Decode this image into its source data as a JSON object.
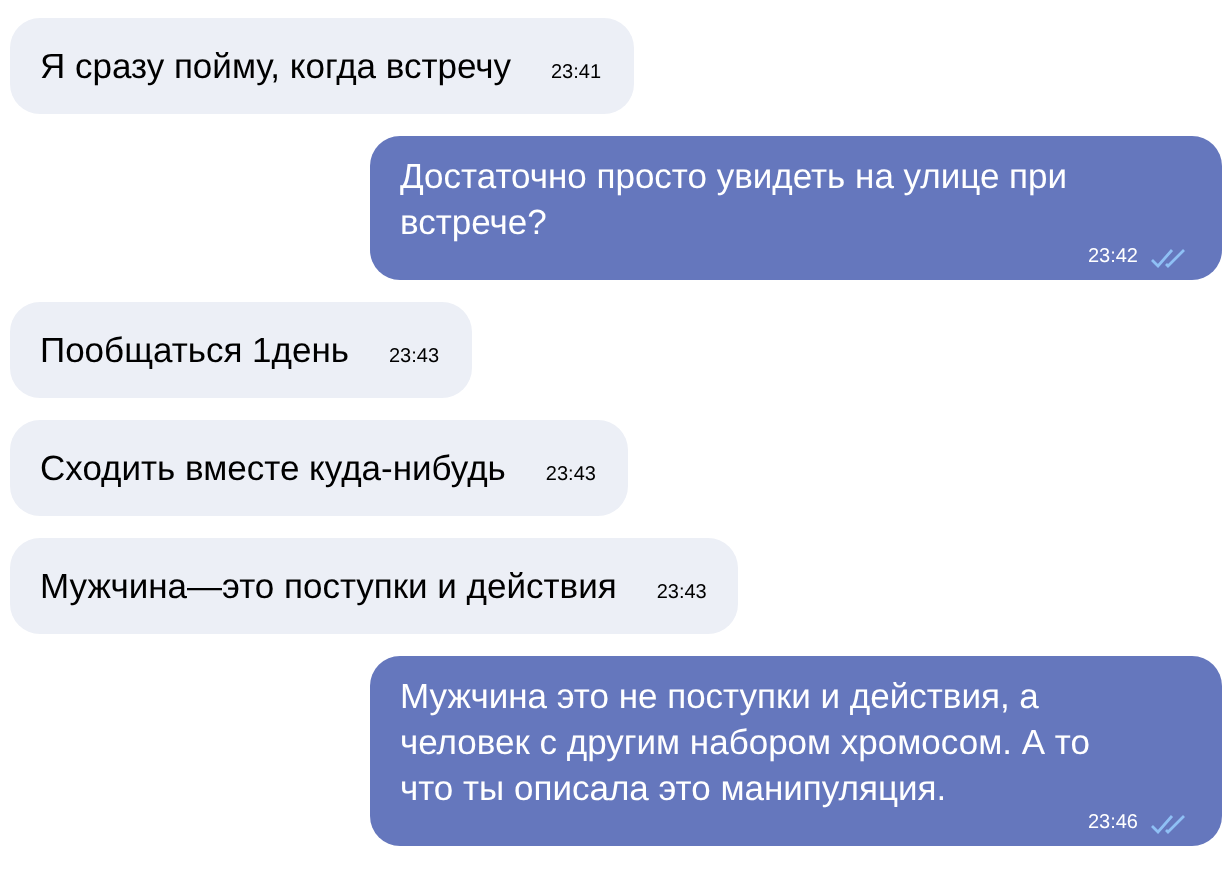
{
  "messages": [
    {
      "kind": "incoming",
      "text": "Я сразу пойму, когда встречу",
      "time": "23:41"
    },
    {
      "kind": "outgoing",
      "text": "Достаточно просто увидеть на улице при встрече?",
      "time": "23:42",
      "read": true
    },
    {
      "kind": "incoming",
      "text": "Пообщаться 1день",
      "time": "23:43"
    },
    {
      "kind": "incoming",
      "text": "Сходить вместе куда-нибудь",
      "time": "23:43"
    },
    {
      "kind": "incoming",
      "text": "Мужчина—это поступки и действия",
      "time": "23:43"
    },
    {
      "kind": "outgoing",
      "text": "Мужчина это не поступки и действия, а человек с другим набором хромосом. А то что ты описала это манипуляция.",
      "time": "23:46",
      "read": true
    }
  ]
}
